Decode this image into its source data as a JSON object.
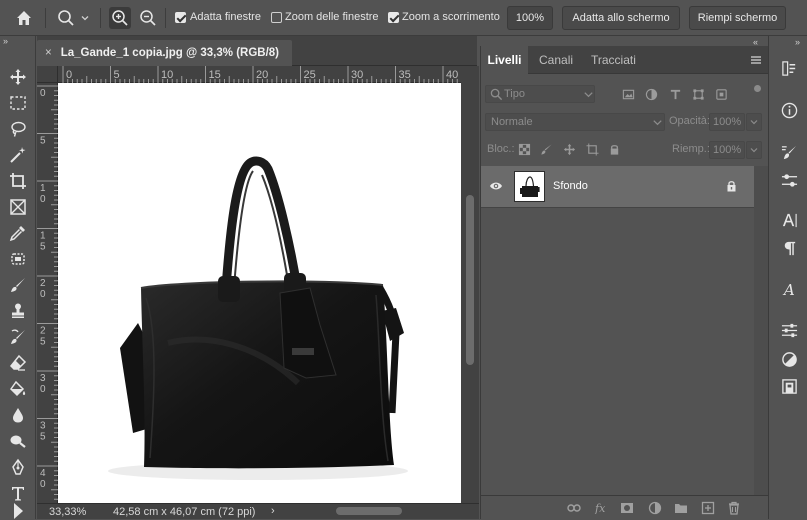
{
  "options_bar": {
    "fit_windows_label": "Adatta finestre",
    "fit_windows_checked": true,
    "zoom_windows_label": "Zoom delle finestre",
    "zoom_windows_checked": false,
    "scrubby_zoom_label": "Zoom a scorrimento",
    "scrubby_zoom_checked": true,
    "zoom_value": "100%",
    "fit_screen_label": "Adatta allo schermo",
    "fill_screen_label": "Riempi schermo"
  },
  "document": {
    "tab_title": "La_Gande_1 copia.jpg @ 33,3% (RGB/8)",
    "close_glyph": "×"
  },
  "rulers": {
    "top": [
      "0",
      "5",
      "10",
      "15",
      "20",
      "25",
      "30",
      "35",
      "40"
    ],
    "left": [
      "0",
      "5",
      "1\n0",
      "1\n5",
      "2\n0",
      "2\n5",
      "3\n0",
      "3\n5",
      "4\n0",
      "4\n5"
    ]
  },
  "status": {
    "zoom": "33,33%",
    "doc_info": "42,58 cm x 46,07 cm (72 ppi)",
    "arrow": "›"
  },
  "layers_panel": {
    "tabs": [
      {
        "label": "Livelli",
        "active": true
      },
      {
        "label": "Canali",
        "active": false
      },
      {
        "label": "Tracciati",
        "active": false
      }
    ],
    "filter_placeholder": "Tipo",
    "blend_mode": "Normale",
    "opacity_label": "Opacità:",
    "opacity_value": "100%",
    "lock_label": "Bloc.:",
    "fill_label": "Riemp.:",
    "fill_value": "100%",
    "layers": [
      {
        "name": "Sfondo",
        "visible": true,
        "locked": true
      }
    ]
  },
  "colors": {
    "panel_bg": "#535353",
    "dark_bg": "#424242",
    "selected_layer": "#6b6b6b",
    "canvas": "#ffffff"
  }
}
